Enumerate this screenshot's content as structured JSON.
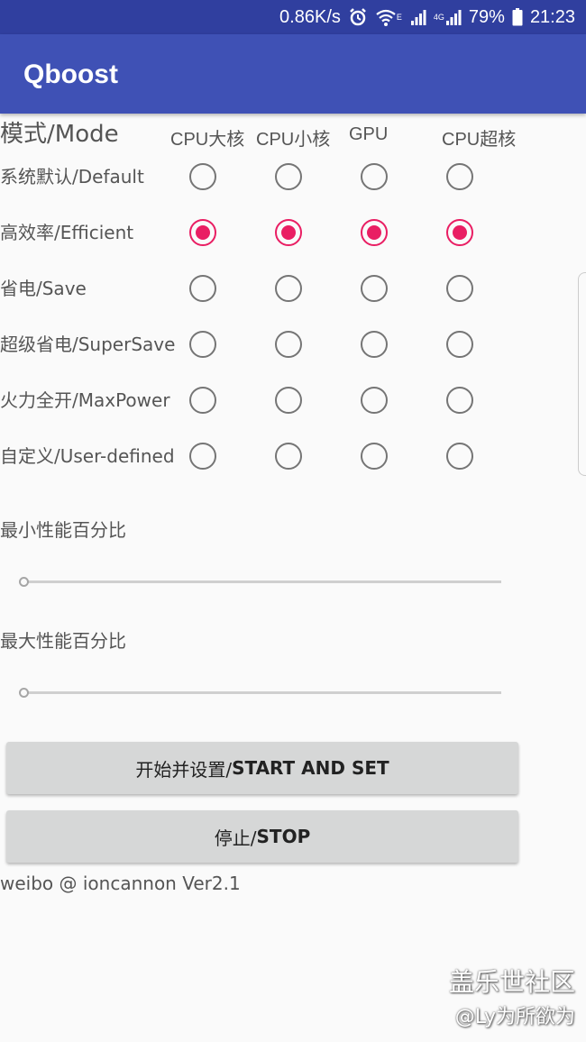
{
  "status_bar": {
    "speed": "0.86K/s",
    "wifi_mark": "E",
    "network_type": "4G",
    "battery_percent": "79%",
    "time": "21:23",
    "icons": [
      "alarm-icon",
      "wifi-icon",
      "signal-icon",
      "battery-icon"
    ]
  },
  "app_bar": {
    "title": "Qboost"
  },
  "modes": {
    "header": "模式/Mode",
    "columns": [
      "CPU大核",
      "CPU小核",
      "GPU",
      "CPU超核"
    ],
    "rows": [
      {
        "label": "系统默认/Default",
        "checked": [
          false,
          false,
          false,
          false
        ]
      },
      {
        "label": "高效率/Efficient",
        "checked": [
          true,
          true,
          true,
          true
        ]
      },
      {
        "label": "省电/Save",
        "checked": [
          false,
          false,
          false,
          false
        ]
      },
      {
        "label": "超级省电/SuperSave",
        "checked": [
          false,
          false,
          false,
          false
        ]
      },
      {
        "label": "火力全开/MaxPower",
        "checked": [
          false,
          false,
          false,
          false
        ]
      },
      {
        "label": "自定义/User-defined",
        "checked": [
          false,
          false,
          false,
          false
        ]
      }
    ]
  },
  "sliders": {
    "min": {
      "label": "最小性能百分比",
      "value": 0
    },
    "max": {
      "label": "最大性能百分比",
      "value": 0
    }
  },
  "buttons": {
    "start": {
      "label": "开始并设置/",
      "label_bold": "START AND SET"
    },
    "stop": {
      "label": "停止/",
      "label_bold": "STOP"
    }
  },
  "footer": {
    "text": "weibo @ ioncannon Ver2.1"
  },
  "watermark": {
    "line1": "盖乐世社区",
    "line2": "@Ly为所欲为"
  },
  "colors": {
    "status_bar": "#303f9f",
    "app_bar": "#3f51b5",
    "accent": "#e91e63",
    "button": "#d6d7d7"
  }
}
